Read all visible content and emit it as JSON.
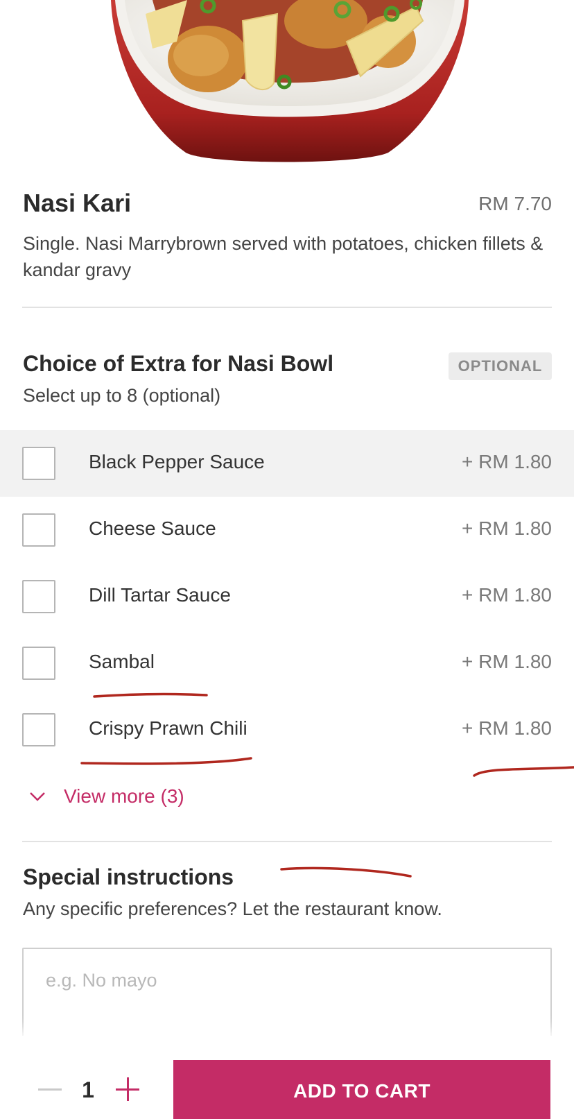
{
  "product": {
    "name": "Nasi Kari",
    "price": "RM 7.70",
    "description": "Single. Nasi Marrybrown served with potatoes, chicken fillets & kandar gravy"
  },
  "extras": {
    "title": "Choice of Extra for Nasi Bowl",
    "badge": "OPTIONAL",
    "subtitle": "Select up to 8 (optional)",
    "options": [
      {
        "label": "Black Pepper Sauce",
        "price": "+ RM 1.80"
      },
      {
        "label": "Cheese Sauce",
        "price": "+ RM 1.80"
      },
      {
        "label": "Dill Tartar Sauce",
        "price": "+ RM 1.80"
      },
      {
        "label": "Sambal",
        "price": "+ RM 1.80"
      },
      {
        "label": "Crispy Prawn Chili",
        "price": "+ RM 1.80"
      }
    ],
    "view_more": "View more (3)"
  },
  "special": {
    "title": "Special instructions",
    "subtitle": "Any specific preferences? Let the restaurant know.",
    "placeholder": "e.g. No mayo",
    "value": ""
  },
  "cart": {
    "quantity": "1",
    "add_label": "ADD TO CART"
  },
  "colors": {
    "accent": "#c42c66",
    "annotation": "#b0271e",
    "bowl": "#b52a2a"
  },
  "icons": {
    "view_more": "chevron-down-icon",
    "decrease": "minus-icon",
    "increase": "plus-icon"
  }
}
